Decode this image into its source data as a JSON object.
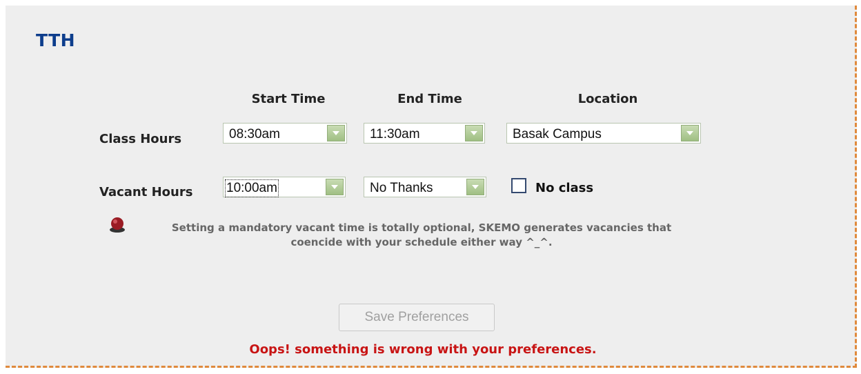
{
  "title": "TTH",
  "columns": {
    "start_time": "Start Time",
    "end_time": "End Time",
    "location": "Location"
  },
  "rows": {
    "class_hours_label": "Class Hours",
    "vacant_hours_label": "Vacant Hours"
  },
  "class_hours": {
    "start": "08:30am",
    "end": "11:30am",
    "location": "Basak Campus"
  },
  "vacant_hours": {
    "start": "10:00am",
    "end": "No Thanks"
  },
  "no_class": {
    "label": "No class",
    "checked": false
  },
  "note": {
    "line1": "Setting a mandatory vacant time is totally optional, SKEMO generates vacancies that",
    "line2": "coencide with your schedule either way ^_^."
  },
  "save_button": "Save Preferences",
  "error_message": "Oops! something is wrong with your preferences.",
  "colors": {
    "title": "#0d3d8c",
    "border": "#e08a3c",
    "error": "#c81414",
    "dropdown_arrow": "#9fbf83"
  }
}
